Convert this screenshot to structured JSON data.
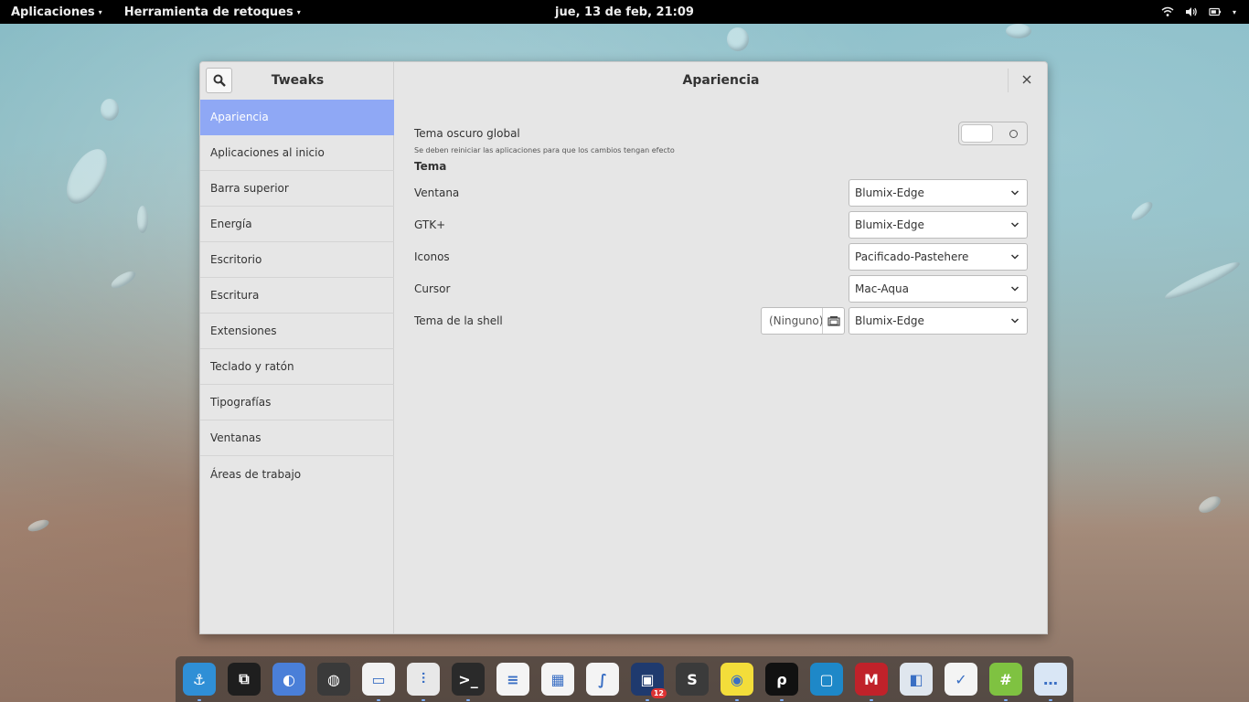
{
  "topbar": {
    "apps_menu": "Aplicaciones",
    "app_menu": "Herramienta de retoques",
    "clock": "jue, 13 de feb, 21:09"
  },
  "window": {
    "sidebar_title": "Tweaks",
    "content_title": "Apariencia",
    "sidebar_items": [
      {
        "label": "Apariencia",
        "active": true
      },
      {
        "label": "Aplicaciones al inicio"
      },
      {
        "label": "Barra superior"
      },
      {
        "label": "Energía"
      },
      {
        "label": "Escritorio"
      },
      {
        "label": "Escritura"
      },
      {
        "label": "Extensiones"
      },
      {
        "label": "Teclado y ratón"
      },
      {
        "label": "Tipografías"
      },
      {
        "label": "Ventanas"
      },
      {
        "label": "Áreas de trabajo"
      }
    ],
    "dark_theme": {
      "label": "Tema oscuro global",
      "hint": "Se deben reiniciar las aplicaciones para que los cambios tengan efecto",
      "enabled": false
    },
    "theme_section": "Tema",
    "theme_rows": [
      {
        "label": "Ventana",
        "value": "Blumix-Edge"
      },
      {
        "label": "GTK+",
        "value": "Blumix-Edge"
      },
      {
        "label": "Iconos",
        "value": "Pacificado-Pastehere"
      },
      {
        "label": "Cursor",
        "value": "Mac-Aqua"
      },
      {
        "label": "Tema de la shell",
        "value": "Blumix-Edge",
        "file": "(Ninguno)"
      }
    ]
  },
  "dock": {
    "items": [
      {
        "icon": "anchor-icon",
        "color": "#2f8fd6"
      },
      {
        "icon": "screenshot-tool-icon",
        "color": "#1e1e1e"
      },
      {
        "icon": "firefox-icon",
        "color": "#4a7fd8"
      },
      {
        "icon": "globe-icon",
        "color": "#3a3a3a"
      },
      {
        "icon": "folder-icon",
        "color": "#f2f2f2"
      },
      {
        "icon": "tweaks-icon",
        "color": "#e8e8e8"
      },
      {
        "icon": "terminal-icon",
        "color": "#2a2a2a"
      },
      {
        "icon": "writer-icon",
        "color": "#f4f4f4"
      },
      {
        "icon": "calc-icon",
        "color": "#f4f4f4"
      },
      {
        "icon": "math-icon",
        "color": "#f4f4f4"
      },
      {
        "icon": "calendar-icon",
        "color": "#1f3a6e",
        "badge": "12"
      },
      {
        "icon": "sublime-icon",
        "color": "#3b3b3b"
      },
      {
        "icon": "bulb-icon",
        "color": "#f3dd3a"
      },
      {
        "icon": "pen-icon",
        "color": "#111111"
      },
      {
        "icon": "window-icon",
        "color": "#1e88c8"
      },
      {
        "icon": "mendeley-icon",
        "color": "#c0222a"
      },
      {
        "icon": "shapes-icon",
        "color": "#dfe6ee"
      },
      {
        "icon": "tasks-icon",
        "color": "#f4f4f4"
      },
      {
        "icon": "hashtag-icon",
        "color": "#7fc241"
      },
      {
        "icon": "chat-icon",
        "color": "#d9e6f5"
      }
    ]
  }
}
